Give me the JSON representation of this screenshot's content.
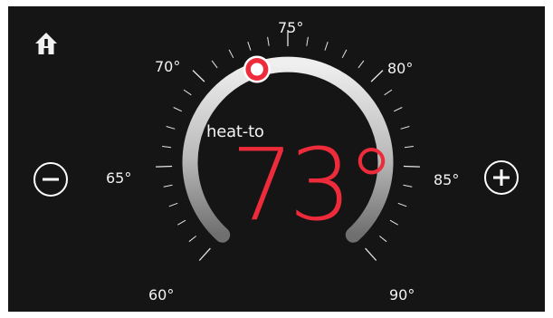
{
  "thermostat": {
    "mode_label": "heat-to",
    "setpoint": "73°",
    "setpoint_value": 73,
    "scale_min": 60,
    "scale_max": 90,
    "labels": {
      "t60": "60°",
      "t65": "65°",
      "t70": "70°",
      "t75": "75°",
      "t80": "80°",
      "t85": "85°",
      "t90": "90°"
    },
    "accent_color": "#ee2b3b"
  },
  "controls": {
    "decrease_icon": "minus-icon",
    "increase_icon": "plus-icon",
    "home_icon": "home-icon"
  }
}
